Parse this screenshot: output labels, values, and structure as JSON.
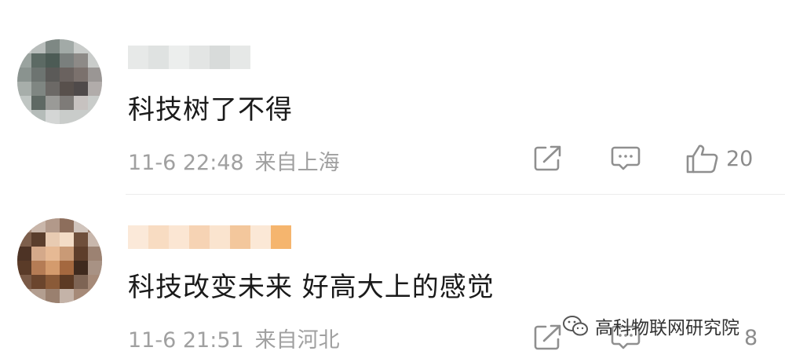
{
  "comments": [
    {
      "text": "科技树了不得",
      "time": "11-6 22:48",
      "location": "来自上海",
      "likes": "20"
    },
    {
      "text": "科技改变未来 好高大上的感觉",
      "time": "11-6 21:51",
      "location": "来自河北",
      "likes": "8"
    }
  ],
  "icons": {
    "share": "share-icon",
    "comment": "comment-icon",
    "like": "thumbs-up-icon",
    "wechat": "wechat-icon"
  },
  "watermark": {
    "text": "高科物联网研究院"
  }
}
